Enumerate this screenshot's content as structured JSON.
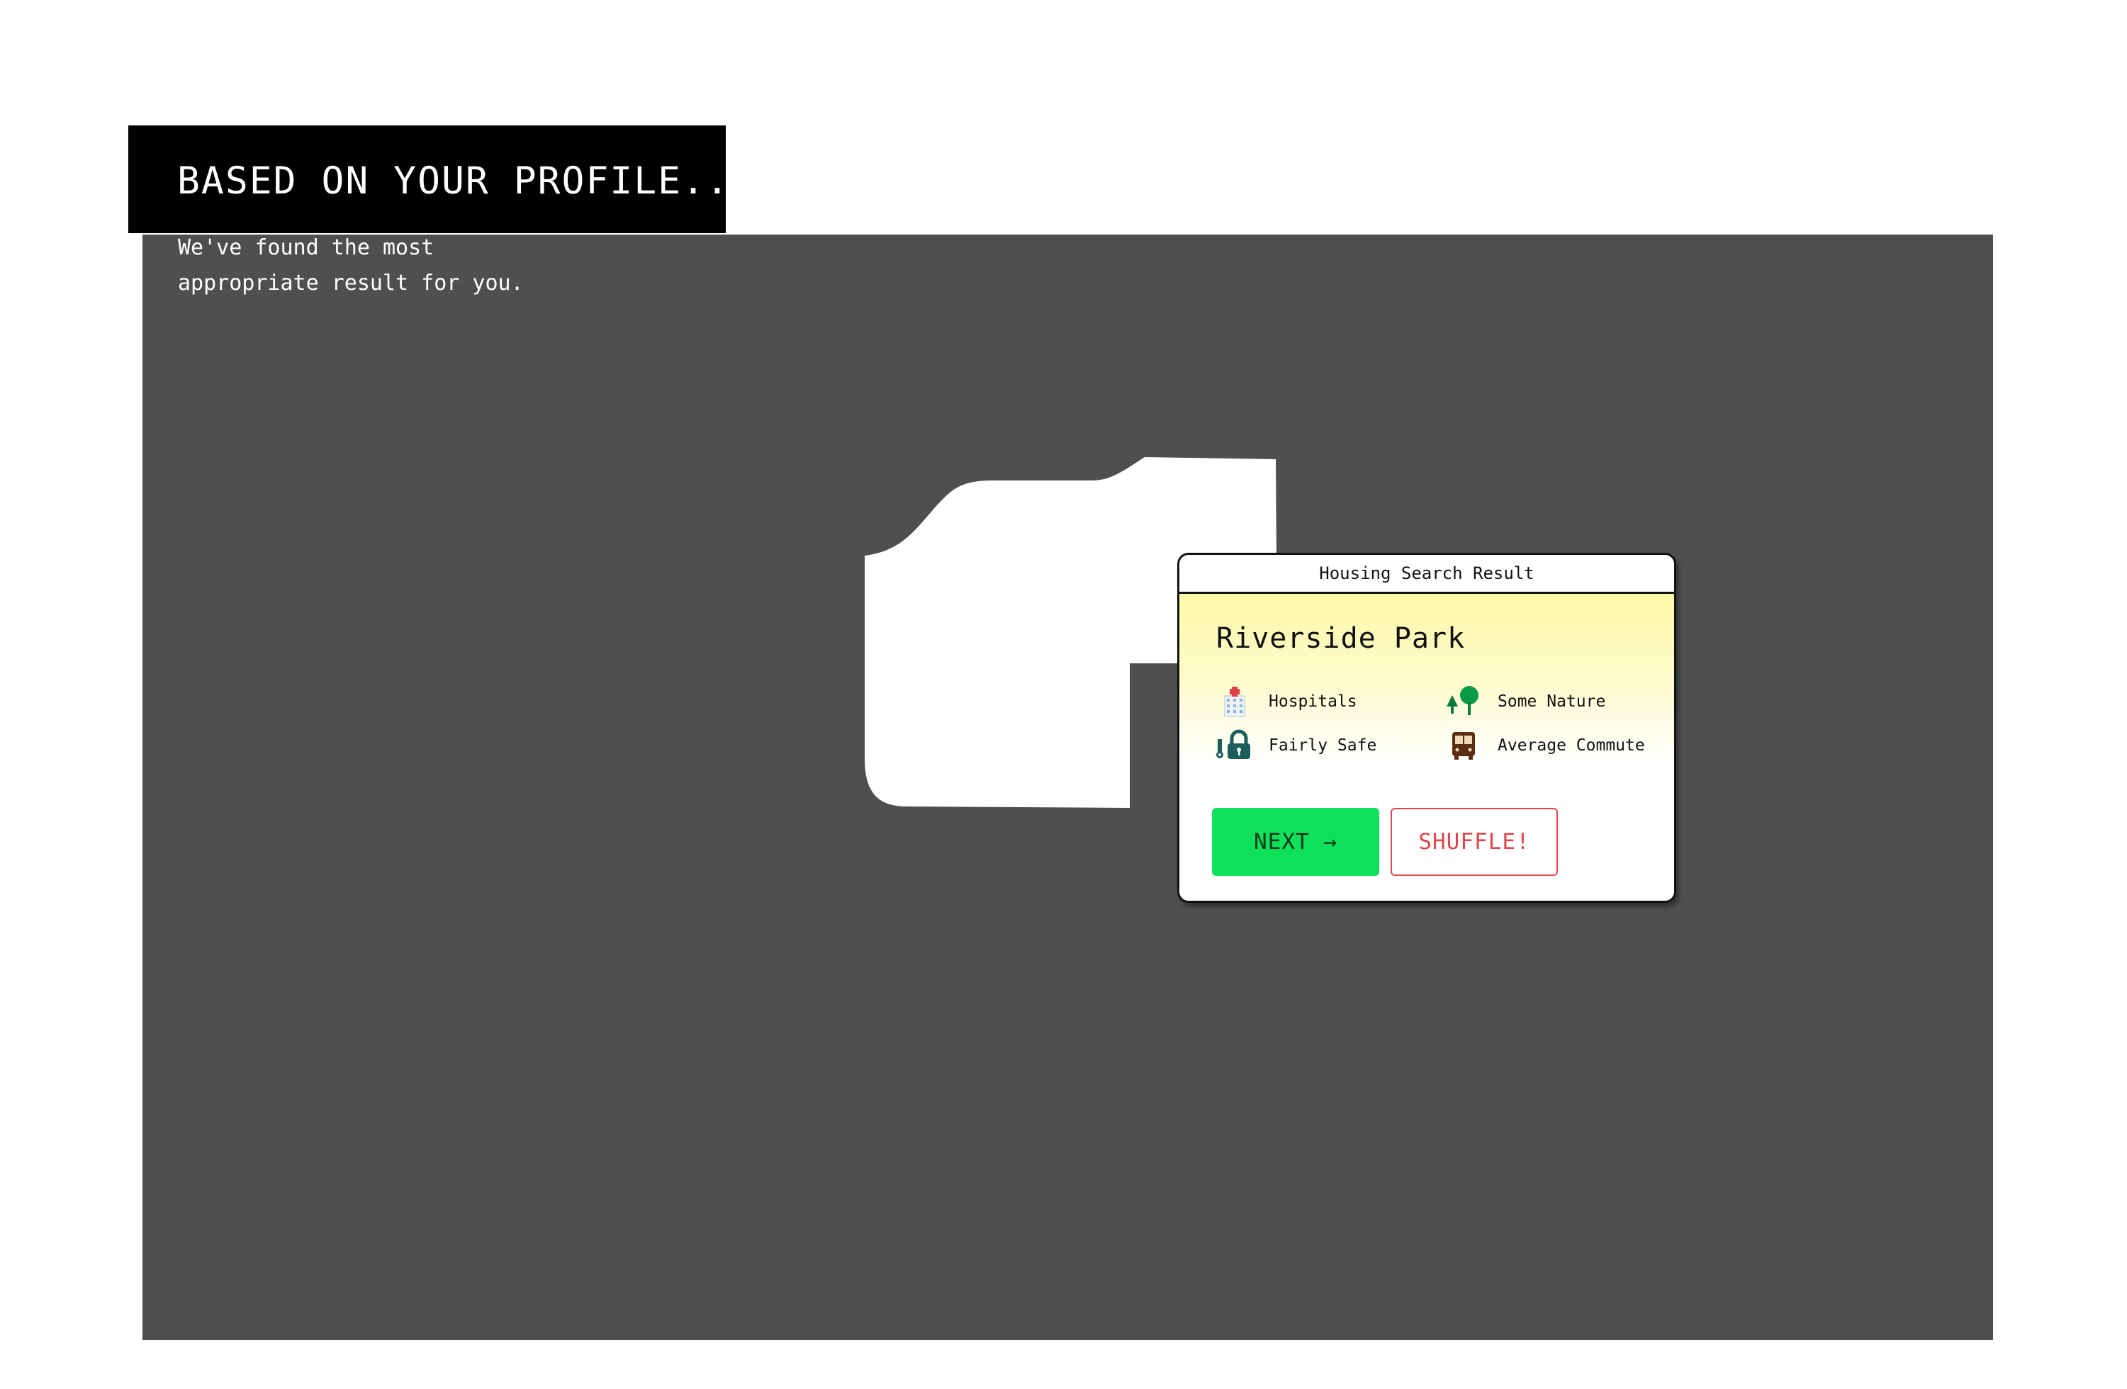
{
  "header": {
    "title": "BASED ON YOUR PROFILE...",
    "subtitle_line1": "We've found the most",
    "subtitle_line2": "appropriate result for you."
  },
  "card": {
    "window_title": "Housing Search Result",
    "place_name": "Riverside Park",
    "features": [
      {
        "icon": "hospital-icon",
        "label": "Hospitals"
      },
      {
        "icon": "trees-icon",
        "label": "Some Nature"
      },
      {
        "icon": "safety-lock-icon",
        "label": "Fairly Safe"
      },
      {
        "icon": "bus-icon",
        "label": "Average Commute"
      }
    ],
    "next_label": "NEXT →",
    "shuffle_label": "SHUFFLE!"
  },
  "colors": {
    "map_background": "#4f4f4f",
    "next_button": "#0ee05a",
    "shuffle_accent": "#e0454b",
    "card_gradient_top": "#fdfaa6"
  }
}
